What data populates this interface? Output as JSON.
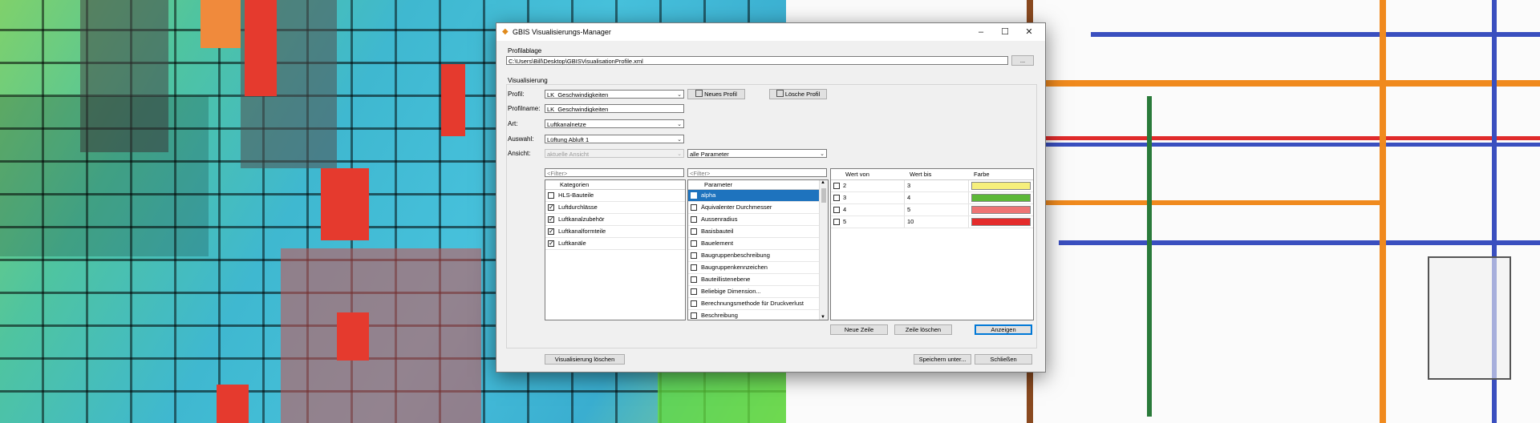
{
  "window": {
    "title": "GBIS Visualisierungs-Manager",
    "minimize": "–",
    "maximize": "☐",
    "close": "✕"
  },
  "profilablage": {
    "label": "Profilablage",
    "path": "C:\\Users\\Bill\\Desktop\\GBISVisualisationProfile.xml",
    "browse": "..."
  },
  "visualisierung": {
    "label": "Visualisierung",
    "profil_label": "Profil:",
    "profil_value": "LK_Geschwindigkeiten",
    "profilname_label": "Profilname:",
    "profilname_value": "LK_Geschwindigkeiten",
    "art_label": "Art:",
    "art_value": "Luftkanalnetze",
    "auswahl_label": "Auswahl:",
    "auswahl_value": "Lüftung Abluft 1",
    "ansicht_label": "Ansicht:",
    "ansicht_value": "aktuelle Ansicht",
    "parameter_filter_value": "alle Parameter",
    "neues_profil": "Neues Profil",
    "loesche_profil": "Lösche Profil"
  },
  "kategorien": {
    "filter_placeholder": "<Filter>",
    "header": "Kategorien",
    "items": [
      {
        "label": "HLS-Bauteile",
        "checked": false
      },
      {
        "label": "Luftdurchlässe",
        "checked": true
      },
      {
        "label": "Luftkanalzubehör",
        "checked": true
      },
      {
        "label": "Luftkanalformteile",
        "checked": true
      },
      {
        "label": "Luftkanäle",
        "checked": true
      }
    ]
  },
  "parameter": {
    "filter_placeholder": "<Filter>",
    "header": "Parameter",
    "items": [
      {
        "label": "alpha",
        "selected": true
      },
      {
        "label": "Äquivalenter Durchmesser"
      },
      {
        "label": "Aussenradius"
      },
      {
        "label": "Basisbauteil"
      },
      {
        "label": "Bauelement"
      },
      {
        "label": "Baugruppenbeschreibung"
      },
      {
        "label": "Baugruppenkennzeichen"
      },
      {
        "label": "Bauteilliste­nebene"
      },
      {
        "label": "Beliebige Dimension..."
      },
      {
        "label": "Berechnungsmethode für Druckverlust"
      },
      {
        "label": "Beschreibung"
      }
    ]
  },
  "werte": {
    "headers": {
      "von": "Wert von",
      "bis": "Wert bis",
      "farbe": "Farbe"
    },
    "rows": [
      {
        "von": "2",
        "bis": "3",
        "color": "#f6ef7c"
      },
      {
        "von": "3",
        "bis": "4",
        "color": "#5cb838"
      },
      {
        "von": "4",
        "bis": "5",
        "color": "#ee7474"
      },
      {
        "von": "5",
        "bis": "10",
        "color": "#e42b2b"
      }
    ],
    "neue_zeile": "Neue Zeile",
    "zeile_loeschen": "Zeile löschen",
    "anzeigen": "Anzeigen"
  },
  "footer": {
    "visualisierung_loeschen": "Visualisierung löschen",
    "speichern_unter": "Speichern unter...",
    "schliessen": "Schließen"
  },
  "colors": {
    "selection": "#1e73be",
    "accent_button": "#0078d7"
  }
}
